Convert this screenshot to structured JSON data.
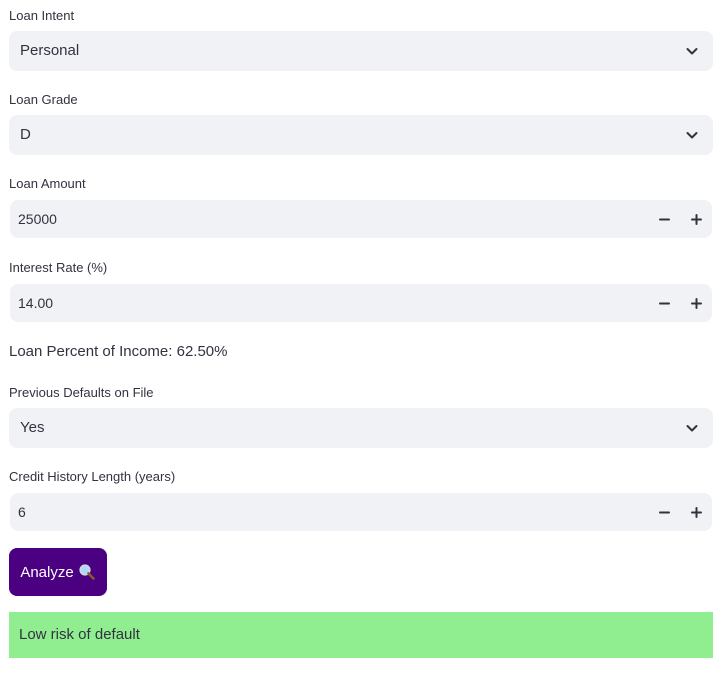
{
  "form": {
    "loan_intent": {
      "label": "Loan Intent",
      "value": "Personal"
    },
    "loan_grade": {
      "label": "Loan Grade",
      "value": "D"
    },
    "loan_amount": {
      "label": "Loan Amount",
      "value": "25000"
    },
    "interest_rate": {
      "label": "Interest Rate (%)",
      "value": "14.00"
    },
    "loan_percent_income": "Loan Percent of Income: 62.50%",
    "previous_defaults": {
      "label": "Previous Defaults on File",
      "value": "Yes"
    },
    "credit_history": {
      "label": "Credit History Length (years)",
      "value": "6"
    }
  },
  "analyze_button": {
    "label": "Analyze",
    "icon": "magnifying-glass-icon"
  },
  "result": {
    "text": "Low risk of default",
    "color": "#90ee90"
  },
  "colors": {
    "accent": "#4b0082",
    "input_bg": "#f0f2f6",
    "text": "#31333f"
  }
}
